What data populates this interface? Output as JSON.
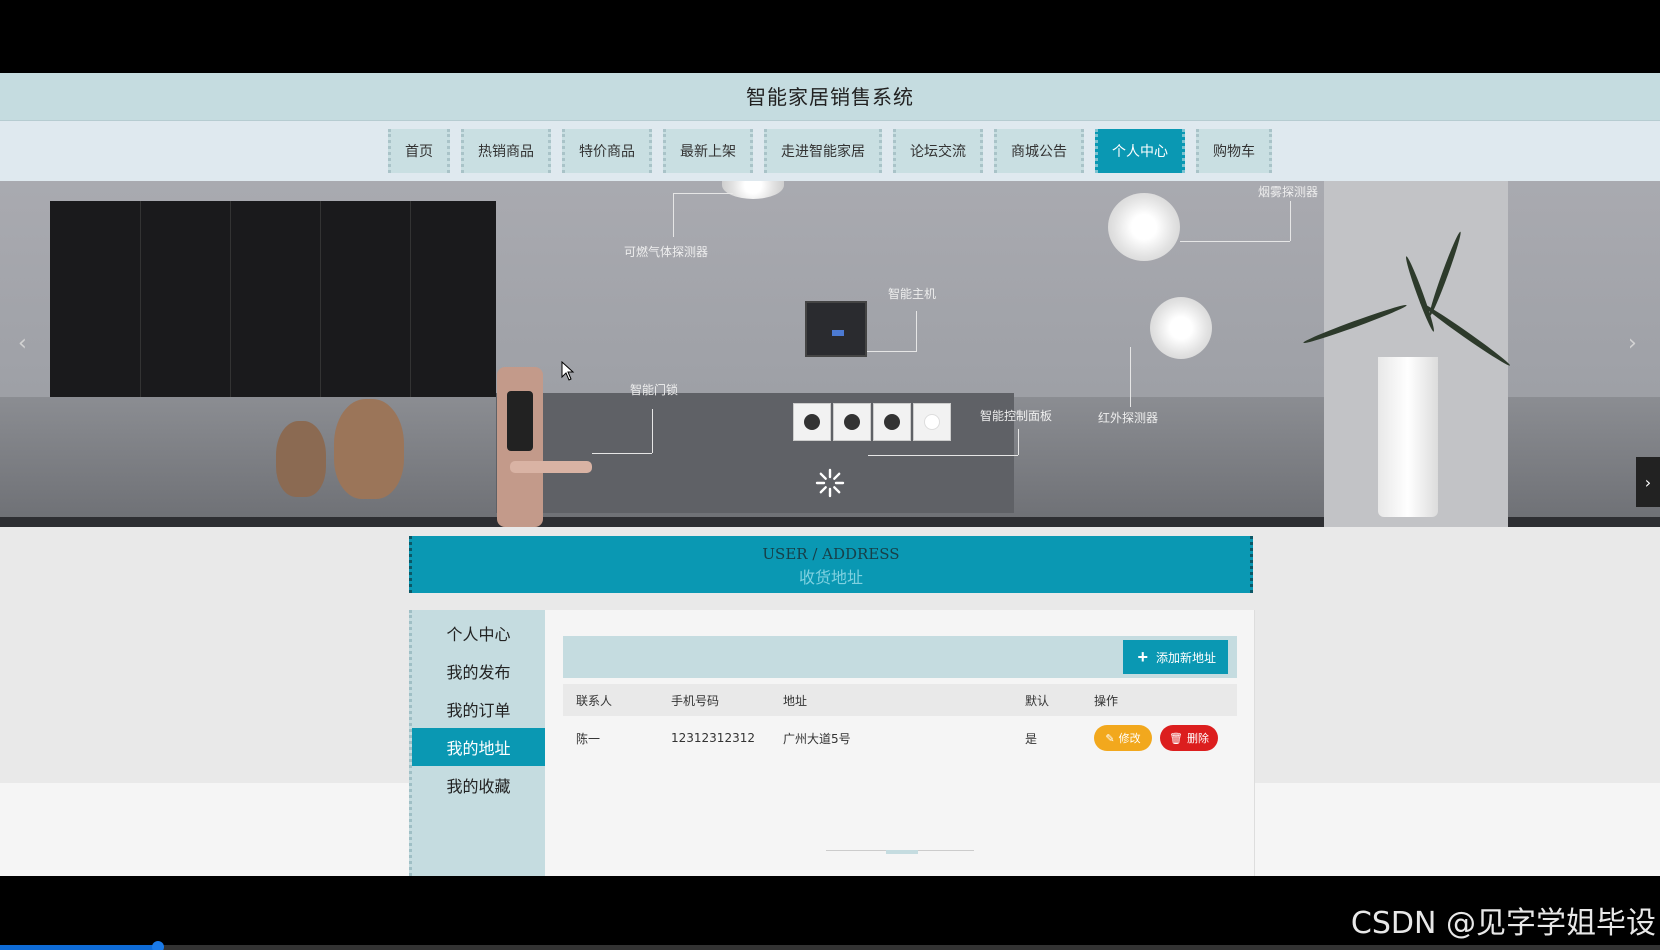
{
  "app": {
    "title": "智能家居销售系统"
  },
  "nav": {
    "items": [
      {
        "label": "首页"
      },
      {
        "label": "热销商品"
      },
      {
        "label": "特价商品"
      },
      {
        "label": "最新上架"
      },
      {
        "label": "走进智能家居"
      },
      {
        "label": "论坛交流"
      },
      {
        "label": "商城公告"
      },
      {
        "label": "个人中心",
        "active": true
      },
      {
        "label": "购物车"
      }
    ]
  },
  "banner": {
    "labels": {
      "gas": "可燃气体探测器",
      "host": "智能主机",
      "smoke": "烟雾探测器",
      "lock": "智能门锁",
      "panel": "智能控制面板",
      "infrared": "红外探测器"
    },
    "prev_icon": "chevron-left-icon",
    "next_icon": "chevron-right-icon"
  },
  "panel": {
    "title_en": "USER / ADDRESS",
    "title_cn": "收货地址"
  },
  "sidebar": {
    "items": [
      {
        "label": "个人中心"
      },
      {
        "label": "我的发布"
      },
      {
        "label": "我的订单"
      },
      {
        "label": "我的地址",
        "active": true
      },
      {
        "label": "我的收藏"
      }
    ]
  },
  "toolbar": {
    "add_label": "添加新地址",
    "add_icon": "plus-icon"
  },
  "table": {
    "headers": {
      "contact": "联系人",
      "phone": "手机号码",
      "address": "地址",
      "default": "默认",
      "actions": "操作"
    },
    "rows": [
      {
        "contact": "陈一",
        "phone": "12312312312",
        "address": "广州大道5号",
        "default": "是",
        "edit_label": "修改",
        "delete_label": "删除"
      }
    ]
  },
  "watermark": "CSDN @见字学姐毕设",
  "video": {
    "progress_fraction": 0.095
  },
  "colors": {
    "accent": "#0a98b3",
    "nav_bg": "#c9dfe2",
    "edit": "#f2a81d",
    "delete": "#dc1e1e"
  }
}
